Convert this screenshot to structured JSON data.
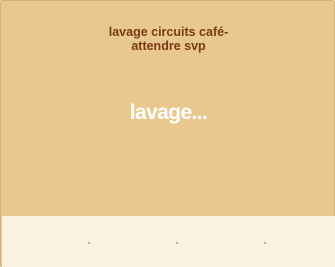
{
  "header": {
    "line1": "lavage circuits café-",
    "line2": "attendre svp"
  },
  "status": {
    "text": "lavage..."
  },
  "bottom_bar": {
    "indicators": 3
  },
  "colors": {
    "background": "#e8c88e",
    "header_text": "#7a3a14",
    "status_text": "#ffffff",
    "bottom_bar": "#faf1e0"
  }
}
